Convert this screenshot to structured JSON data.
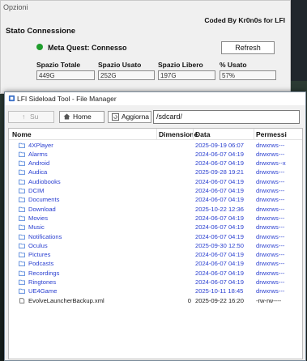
{
  "options_window": {
    "title": "Opzioni",
    "credit": "Coded By Kr0n0s for LFI",
    "section_title": "Stato Connessione",
    "status_text": "Meta Quest: Connesso",
    "status_color": "#1f9d2c",
    "refresh_label": "Refresh",
    "stats": [
      {
        "label": "Spazio Totale",
        "value": "449G"
      },
      {
        "label": "Spazio Usato",
        "value": "252G"
      },
      {
        "label": "Spazio Libero",
        "value": "197G"
      },
      {
        "label": "% Usato",
        "value": "57%"
      }
    ]
  },
  "file_manager": {
    "title": "LFI Sideload Tool - File Manager",
    "toolbar": {
      "up_label": "Su",
      "home_label": "Home",
      "refresh_label": "Aggiorna",
      "path": "/sdcard/"
    },
    "columns": {
      "name": "Nome",
      "size": "Dimensione",
      "date": "Data",
      "perm": "Permessi"
    },
    "rows": [
      {
        "type": "dir",
        "name": "4XPlayer",
        "size": "",
        "date": "2025-09-19 06:07",
        "perm": "drwxrws---"
      },
      {
        "type": "dir",
        "name": "Alarms",
        "size": "",
        "date": "2024-06-07 04:19",
        "perm": "drwxrws---"
      },
      {
        "type": "dir",
        "name": "Android",
        "size": "",
        "date": "2024-06-07 04:19",
        "perm": "drwxrws--x"
      },
      {
        "type": "dir",
        "name": "Audica",
        "size": "",
        "date": "2025-09-28 19:21",
        "perm": "drwxrws---"
      },
      {
        "type": "dir",
        "name": "Audiobooks",
        "size": "",
        "date": "2024-06-07 04:19",
        "perm": "drwxrws---"
      },
      {
        "type": "dir",
        "name": "DCIM",
        "size": "",
        "date": "2024-06-07 04:19",
        "perm": "drwxrws---"
      },
      {
        "type": "dir",
        "name": "Documents",
        "size": "",
        "date": "2024-06-07 04:19",
        "perm": "drwxrws---"
      },
      {
        "type": "dir",
        "name": "Download",
        "size": "",
        "date": "2025-10-22 12:36",
        "perm": "drwxrws---"
      },
      {
        "type": "dir",
        "name": "Movies",
        "size": "",
        "date": "2024-06-07 04:19",
        "perm": "drwxrws---"
      },
      {
        "type": "dir",
        "name": "Music",
        "size": "",
        "date": "2024-06-07 04:19",
        "perm": "drwxrws---"
      },
      {
        "type": "dir",
        "name": "Notifications",
        "size": "",
        "date": "2024-06-07 04:19",
        "perm": "drwxrws---"
      },
      {
        "type": "dir",
        "name": "Oculus",
        "size": "",
        "date": "2025-09-30 12:50",
        "perm": "drwxrws---"
      },
      {
        "type": "dir",
        "name": "Pictures",
        "size": "",
        "date": "2024-06-07 04:19",
        "perm": "drwxrws---"
      },
      {
        "type": "dir",
        "name": "Podcasts",
        "size": "",
        "date": "2024-06-07 04:19",
        "perm": "drwxrws---"
      },
      {
        "type": "dir",
        "name": "Recordings",
        "size": "",
        "date": "2024-06-07 04:19",
        "perm": "drwxrws---"
      },
      {
        "type": "dir",
        "name": "Ringtones",
        "size": "",
        "date": "2024-06-07 04:19",
        "perm": "drwxrws---"
      },
      {
        "type": "dir",
        "name": "UE4Game",
        "size": "",
        "date": "2025-10-11 18:45",
        "perm": "drwxrws---"
      },
      {
        "type": "file",
        "name": "EvolveLauncherBackup.xml",
        "size": "0",
        "date": "2025-09-22 16:20",
        "perm": "-rw-rw----"
      }
    ],
    "colors": {
      "folder_text": "#2a3fd0",
      "folder_icon": "#4a7fd8"
    }
  }
}
